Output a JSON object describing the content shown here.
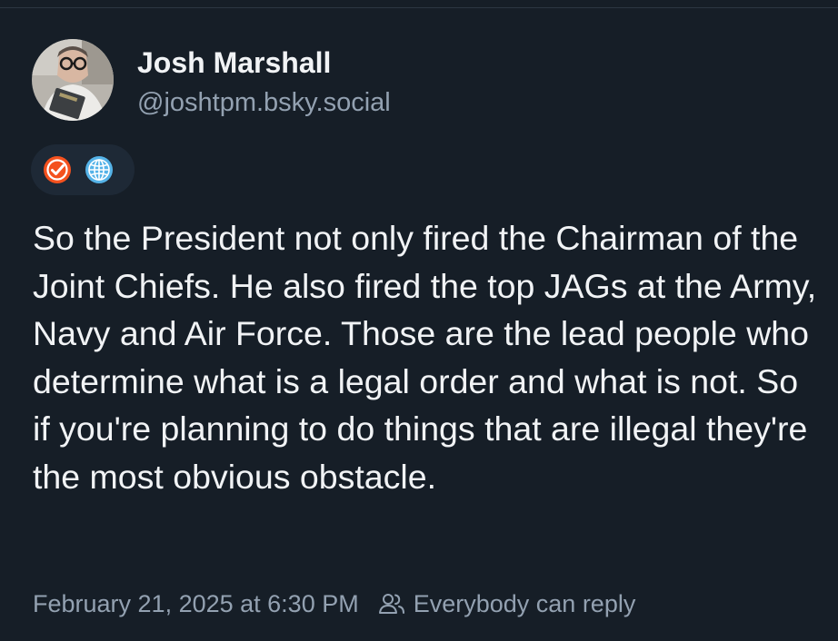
{
  "post": {
    "author": {
      "display_name": "Josh Marshall",
      "handle": "@joshtpm.bsky.social"
    },
    "badges": [
      {
        "icon": "verified-check-icon",
        "color": "#f4511e"
      },
      {
        "icon": "globe-icon",
        "color": "#55b3e8"
      }
    ],
    "text": "So the President not only fired the Chairman of the Joint Chiefs. He also fired the top JAGs at the Army, Navy and Air Force. Those are the lead people who determine what is a legal order and what is not. So if you're planning to do things that are illegal they're the most obvious obstacle.",
    "timestamp": "February 21, 2025 at 6:30 PM",
    "reply_setting": {
      "icon": "people-icon",
      "label": "Everybody can reply"
    }
  },
  "colors": {
    "background": "#161e27",
    "text_primary": "#f1f3f5",
    "text_secondary": "#93a1b1",
    "badge_pill": "#1e2936"
  }
}
